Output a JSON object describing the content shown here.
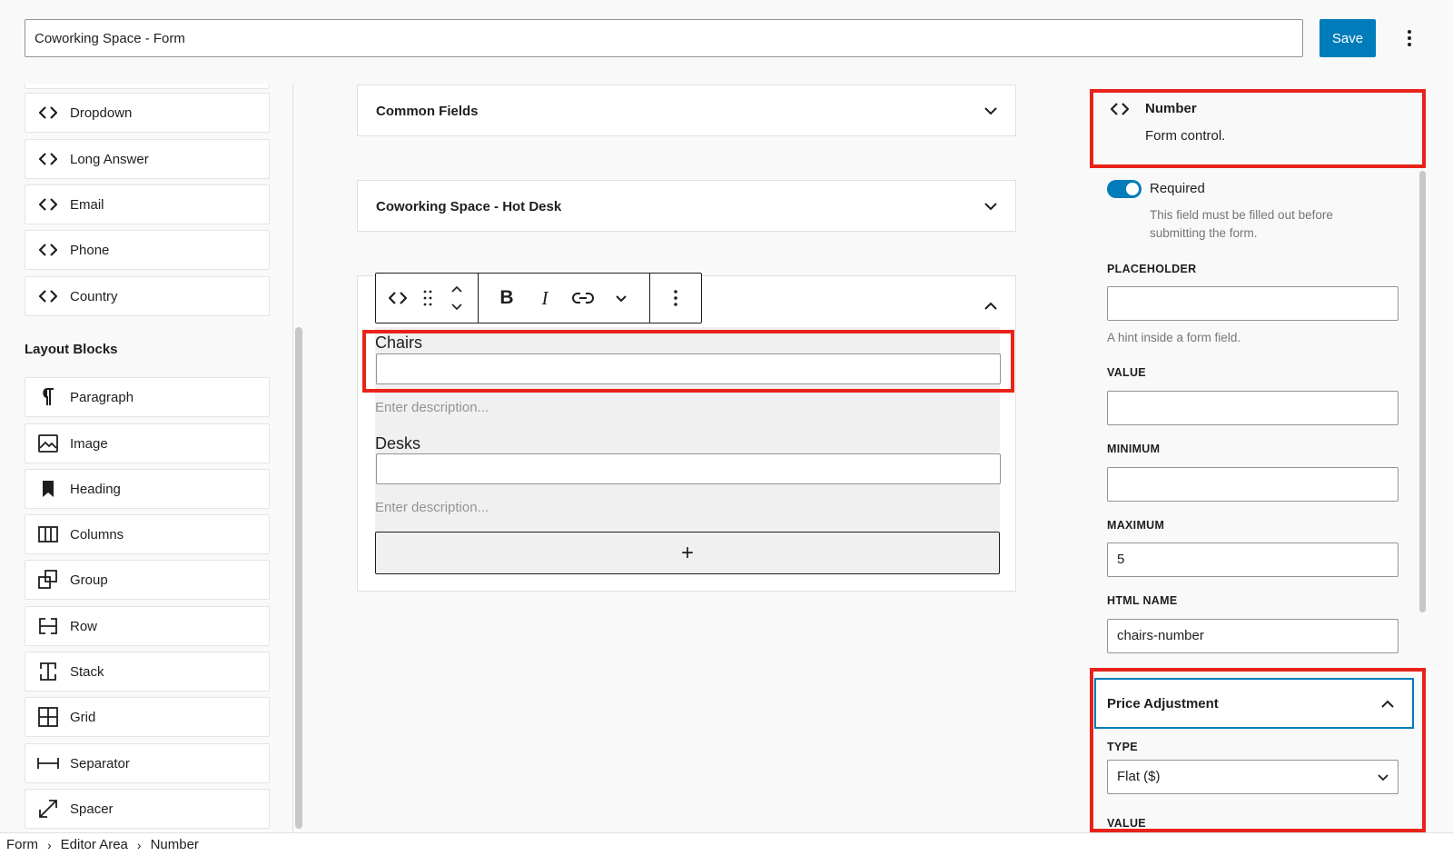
{
  "header": {
    "title": "Coworking Space - Form",
    "save_label": "Save"
  },
  "sidebar": {
    "form_blocks": [
      {
        "label": "Dropdown",
        "icon": "code-icon"
      },
      {
        "label": "Long Answer",
        "icon": "code-icon"
      },
      {
        "label": "Email",
        "icon": "code-icon"
      },
      {
        "label": "Phone",
        "icon": "code-icon"
      },
      {
        "label": "Country",
        "icon": "code-icon"
      }
    ],
    "layout_title": "Layout Blocks",
    "layout_blocks": [
      {
        "label": "Paragraph",
        "icon": "paragraph-icon"
      },
      {
        "label": "Image",
        "icon": "image-icon"
      },
      {
        "label": "Heading",
        "icon": "heading-icon"
      },
      {
        "label": "Columns",
        "icon": "columns-icon"
      },
      {
        "label": "Group",
        "icon": "group-icon"
      },
      {
        "label": "Row",
        "icon": "row-icon"
      },
      {
        "label": "Stack",
        "icon": "stack-icon"
      },
      {
        "label": "Grid",
        "icon": "grid-icon"
      },
      {
        "label": "Separator",
        "icon": "separator-icon"
      },
      {
        "label": "Spacer",
        "icon": "spacer-icon"
      }
    ]
  },
  "editor": {
    "panels": [
      "Common Fields",
      "Coworking Space - Hot Desk"
    ],
    "fields": [
      {
        "label": "Chairs",
        "description_placeholder": "Enter description..."
      },
      {
        "label": "Desks",
        "description_placeholder": "Enter description..."
      }
    ],
    "add_label": "+"
  },
  "inspector": {
    "block_name": "Number",
    "block_description": "Form control.",
    "required_label": "Required",
    "required_on": true,
    "required_help": "This field must be filled out before submitting the form.",
    "placeholder_label": "PLACEHOLDER",
    "placeholder_value": "",
    "placeholder_help": "A hint inside a form field.",
    "value_label": "VALUE",
    "value_value": "",
    "minimum_label": "MINIMUM",
    "minimum_value": "",
    "maximum_label": "MAXIMUM",
    "maximum_value": "5",
    "html_name_label": "HTML NAME",
    "html_name_value": "chairs-number",
    "price_adjustment_title": "Price Adjustment",
    "type_label": "TYPE",
    "type_value": "Flat ($)",
    "price_value_label": "VALUE"
  },
  "breadcrumb": [
    "Form",
    "Editor Area",
    "Number"
  ],
  "colors": {
    "accent": "#007cba",
    "highlight": "#e8231a"
  }
}
